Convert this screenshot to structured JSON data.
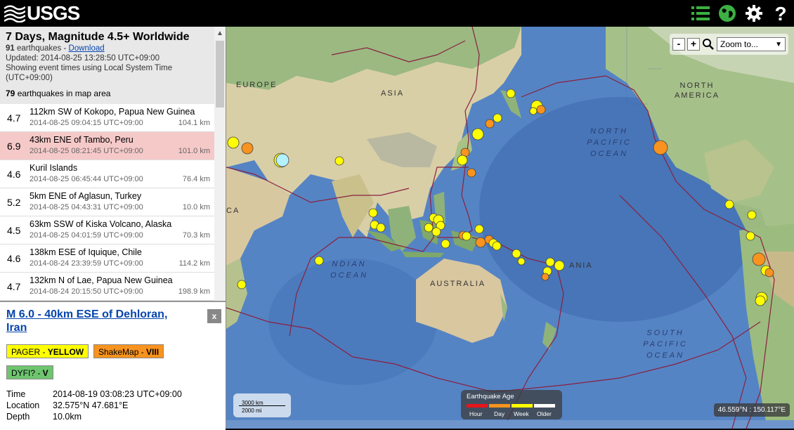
{
  "app": {
    "logo_text": "USGS"
  },
  "toolbar": {
    "icons": [
      "list-icon",
      "globe-icon",
      "gear-icon",
      "help-icon"
    ]
  },
  "list_header": {
    "title": "7 Days, Magnitude 4.5+ Worldwide",
    "count": "91",
    "count_suffix": "earthquakes - ",
    "download_label": "Download",
    "updated": "Updated: 2014-08-25 13:28:50 UTC+09:00",
    "tz_note": "Showing event times using Local System Time (UTC+09:00)",
    "in_map_count": "79",
    "in_map_suffix": "earthquakes in map area"
  },
  "earthquakes": [
    {
      "mag": "4.7",
      "place": "112km SW of Kokopo, Papua New Guinea",
      "time": "2014-08-25 09:04:15 UTC+09:00",
      "depth": "104.1 km"
    },
    {
      "mag": "6.9",
      "place": "43km ENE of Tambo, Peru",
      "time": "2014-08-25 08:21:45 UTC+09:00",
      "depth": "101.0 km"
    },
    {
      "mag": "4.6",
      "place": "Kuril Islands",
      "time": "2014-08-25 06:45:44 UTC+09:00",
      "depth": "76.4 km"
    },
    {
      "mag": "5.2",
      "place": "5km ENE of Aglasun, Turkey",
      "time": "2014-08-25 04:43:31 UTC+09:00",
      "depth": "10.0 km"
    },
    {
      "mag": "4.5",
      "place": "63km SSW of Kiska Volcano, Alaska",
      "time": "2014-08-25 04:01:59 UTC+09:00",
      "depth": "70.3 km"
    },
    {
      "mag": "4.6",
      "place": "138km ESE of Iquique, Chile",
      "time": "2014-08-24 23:39:59 UTC+09:00",
      "depth": "114.2 km"
    },
    {
      "mag": "4.7",
      "place": "132km N of Lae, Papua New Guinea",
      "time": "2014-08-24 20:15:50 UTC+09:00",
      "depth": "198.9 km"
    }
  ],
  "details": {
    "title": "M 6.0 - 40km ESE of Dehloran, Iran",
    "close_label": "x",
    "pager_label": "PAGER - ",
    "pager_value": "YELLOW",
    "shakemap_label": "ShakeMap - ",
    "shakemap_value": "VIII",
    "dyfi_label": "DYFI? - ",
    "dyfi_value": "V",
    "time_key": "Time",
    "time_value": "2014-08-19 03:08:23 UTC+09:00",
    "location_key": "Location",
    "location_value": "32.575°N 47.681°E",
    "depth_key": "Depth",
    "depth_value": "10.0km"
  },
  "map": {
    "zoom_minus": "-",
    "zoom_plus": "+",
    "zoom_select": "Zoom to...",
    "scale_km": "3000 km",
    "scale_mi": "2000 mi",
    "legend_title": "Earthquake Age",
    "legend_items": [
      "Hour",
      "Day",
      "Week",
      "Older"
    ],
    "legend_colors": [
      "#e8141c",
      "#f7931e",
      "#ffff00",
      "#ffffff"
    ],
    "coords": "46.559°N : 150.117°E",
    "labels": {
      "europe": "EUROPE",
      "asia": "ASIA",
      "north_america": "NORTH AMERICA",
      "australia": "AUSTRALIA",
      "oceania": "ANIA",
      "africa": "CA",
      "north_pacific": "NORTH PACIFIC OCEAN",
      "south_pacific": "SOUTH PACIFIC OCEAN",
      "indian_ocean": "NDIAN OCEAN"
    }
  }
}
